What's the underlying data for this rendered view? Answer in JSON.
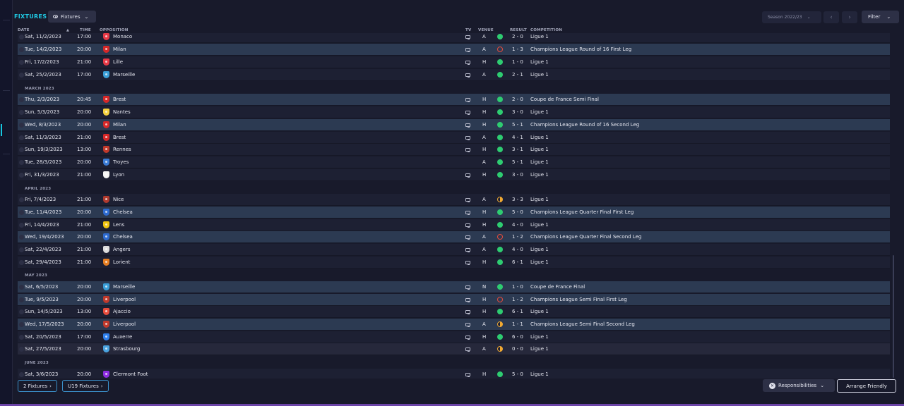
{
  "header": {
    "title": "FIXTURES",
    "view_label": "Fixtures",
    "season": "Season 2022/23",
    "filter_label": "Filter",
    "prev_icon": "‹",
    "next_icon": "›",
    "chevron": "⌄"
  },
  "columns": {
    "date": "DATE",
    "time": "TIME",
    "opposition": "OPPOSITION",
    "tv": "TV",
    "venue": "VENUE",
    "result": "RESULT",
    "competition": "COMPETITION",
    "sort_icon": "▲"
  },
  "rows": [
    {
      "kind": "fixture",
      "date": "Sat, 11/2/2023",
      "time": "17:00",
      "opp": "Monaco",
      "crest": "#e63946",
      "tv": true,
      "venue": "A",
      "outcome": "W",
      "score": "2 - 0",
      "comp": "Ligue 1",
      "style": ""
    },
    {
      "kind": "fixture",
      "date": "Tue, 14/2/2023",
      "time": "20:00",
      "opp": "Milan",
      "crest": "#d62828",
      "tv": true,
      "venue": "A",
      "outcome": "L",
      "score": "1 - 3",
      "comp": "Champions League Round of 16  First Leg",
      "style": "hl"
    },
    {
      "kind": "fixture",
      "date": "Fri, 17/2/2023",
      "time": "21:00",
      "opp": "Lille",
      "crest": "#e63946",
      "tv": true,
      "venue": "H",
      "outcome": "W",
      "score": "1 - 0",
      "comp": "Ligue 1",
      "style": ""
    },
    {
      "kind": "fixture",
      "date": "Sat, 25/2/2023",
      "time": "17:00",
      "opp": "Marseille",
      "crest": "#3a9fd8",
      "tv": true,
      "venue": "A",
      "outcome": "W",
      "score": "2 - 1",
      "comp": "Ligue 1",
      "style": ""
    },
    {
      "kind": "month",
      "label": "MARCH 2023"
    },
    {
      "kind": "fixture",
      "date": "Thu, 2/3/2023",
      "time": "20:45",
      "opp": "Brest",
      "crest": "#d62828",
      "tv": true,
      "venue": "H",
      "outcome": "W",
      "score": "2 - 0",
      "comp": "Coupe de France Semi Final",
      "style": "hl"
    },
    {
      "kind": "fixture",
      "date": "Sun, 5/3/2023",
      "time": "20:00",
      "opp": "Nantes",
      "crest": "#f4d03f",
      "tv": true,
      "venue": "H",
      "outcome": "W",
      "score": "3 - 0",
      "comp": "Ligue 1",
      "style": ""
    },
    {
      "kind": "fixture",
      "date": "Wed, 8/3/2023",
      "time": "20:00",
      "opp": "Milan",
      "crest": "#d62828",
      "tv": true,
      "venue": "H",
      "outcome": "W",
      "score": "5 - 1",
      "comp": "Champions League Round of 16  Second Leg",
      "style": "hl"
    },
    {
      "kind": "fixture",
      "date": "Sat, 11/3/2023",
      "time": "21:00",
      "opp": "Brest",
      "crest": "#d62828",
      "tv": true,
      "venue": "A",
      "outcome": "W",
      "score": "4 - 1",
      "comp": "Ligue 1",
      "style": ""
    },
    {
      "kind": "fixture",
      "date": "Sun, 19/3/2023",
      "time": "13:00",
      "opp": "Rennes",
      "crest": "#c0392b",
      "tv": true,
      "venue": "H",
      "outcome": "W",
      "score": "3 - 1",
      "comp": "Ligue 1",
      "style": ""
    },
    {
      "kind": "fixture",
      "date": "Tue, 28/3/2023",
      "time": "20:00",
      "opp": "Troyes",
      "crest": "#3a7bd5",
      "tv": false,
      "venue": "A",
      "outcome": "W",
      "score": "5 - 1",
      "comp": "Ligue 1",
      "style": ""
    },
    {
      "kind": "fixture",
      "date": "Fri, 31/3/2023",
      "time": "21:00",
      "opp": "Lyon",
      "crest": "#f5f5f5",
      "tv": true,
      "venue": "H",
      "outcome": "W",
      "score": "3 - 0",
      "comp": "Ligue 1",
      "style": ""
    },
    {
      "kind": "month",
      "label": "APRIL 2023"
    },
    {
      "kind": "fixture",
      "date": "Fri, 7/4/2023",
      "time": "21:00",
      "opp": "Nice",
      "crest": "#b03a2e",
      "tv": true,
      "venue": "A",
      "outcome": "D",
      "score": "3 - 3",
      "comp": "Ligue 1",
      "style": ""
    },
    {
      "kind": "fixture",
      "date": "Tue, 11/4/2023",
      "time": "20:00",
      "opp": "Chelsea",
      "crest": "#2e6bd1",
      "tv": true,
      "venue": "H",
      "outcome": "W",
      "score": "5 - 0",
      "comp": "Champions League Quarter Final First Leg",
      "style": "hl"
    },
    {
      "kind": "fixture",
      "date": "Fri, 14/4/2023",
      "time": "21:00",
      "opp": "Lens",
      "crest": "#f1c40f",
      "tv": true,
      "venue": "H",
      "outcome": "W",
      "score": "4 - 0",
      "comp": "Ligue 1",
      "style": ""
    },
    {
      "kind": "fixture",
      "date": "Wed, 19/4/2023",
      "time": "20:00",
      "opp": "Chelsea",
      "crest": "#2e6bd1",
      "tv": true,
      "venue": "A",
      "outcome": "L",
      "score": "1 - 2",
      "comp": "Champions League Quarter Final Second Leg",
      "style": "hl"
    },
    {
      "kind": "fixture",
      "date": "Sat, 22/4/2023",
      "time": "21:00",
      "opp": "Angers",
      "crest": "#dcdcdc",
      "tv": true,
      "venue": "A",
      "outcome": "W",
      "score": "4 - 0",
      "comp": "Ligue 1",
      "style": ""
    },
    {
      "kind": "fixture",
      "date": "Sat, 29/4/2023",
      "time": "21:00",
      "opp": "Lorient",
      "crest": "#e67e22",
      "tv": true,
      "venue": "H",
      "outcome": "W",
      "score": "6 - 1",
      "comp": "Ligue 1",
      "style": ""
    },
    {
      "kind": "month",
      "label": "MAY 2023"
    },
    {
      "kind": "fixture",
      "date": "Sat, 6/5/2023",
      "time": "20:00",
      "opp": "Marseille",
      "crest": "#3a9fd8",
      "tv": true,
      "venue": "N",
      "outcome": "W",
      "score": "1 - 0",
      "comp": "Coupe de France Final",
      "style": "hl"
    },
    {
      "kind": "fixture",
      "date": "Tue, 9/5/2023",
      "time": "20:00",
      "opp": "Liverpool",
      "crest": "#c0392b",
      "tv": true,
      "venue": "H",
      "outcome": "L",
      "score": "1 - 2",
      "comp": "Champions League Semi Final First Leg",
      "style": "hl"
    },
    {
      "kind": "fixture",
      "date": "Sun, 14/5/2023",
      "time": "13:00",
      "opp": "Ajaccio",
      "crest": "#e74c3c",
      "tv": true,
      "venue": "H",
      "outcome": "W",
      "score": "6 - 1",
      "comp": "Ligue 1",
      "style": ""
    },
    {
      "kind": "fixture",
      "date": "Wed, 17/5/2023",
      "time": "20:00",
      "opp": "Liverpool",
      "crest": "#c0392b",
      "tv": true,
      "venue": "A",
      "outcome": "D",
      "score": "1 - 1",
      "comp": "Champions League Semi Final Second Leg",
      "style": "hl"
    },
    {
      "kind": "fixture",
      "date": "Sat, 20/5/2023",
      "time": "17:00",
      "opp": "Auxerre",
      "crest": "#2f80ed",
      "tv": true,
      "venue": "H",
      "outcome": "W",
      "score": "6 - 0",
      "comp": "Ligue 1",
      "style": ""
    },
    {
      "kind": "fixture",
      "date": "Sat, 27/5/2023",
      "time": "20:00",
      "opp": "Strasbourg",
      "crest": "#4aa3df",
      "tv": true,
      "venue": "A",
      "outcome": "D",
      "score": "0 - 0",
      "comp": "Ligue 1",
      "style": "alt"
    },
    {
      "kind": "month",
      "label": "JUNE 2023"
    },
    {
      "kind": "fixture",
      "date": "Sat, 3/6/2023",
      "time": "20:00",
      "opp": "Clermont Foot",
      "crest": "#8e2de2",
      "tv": true,
      "venue": "H",
      "outcome": "W",
      "score": "5 - 0",
      "comp": "Ligue 1",
      "style": ""
    }
  ],
  "footer": {
    "fixtures_btn": "2 Fixtures",
    "u19_btn": "U19 Fixtures",
    "responsibilities": "Responsibilities",
    "arrange": "Arrange Friendly",
    "chevron_right": "›",
    "chevron_down": "⌄",
    "x_icon": "✕"
  }
}
